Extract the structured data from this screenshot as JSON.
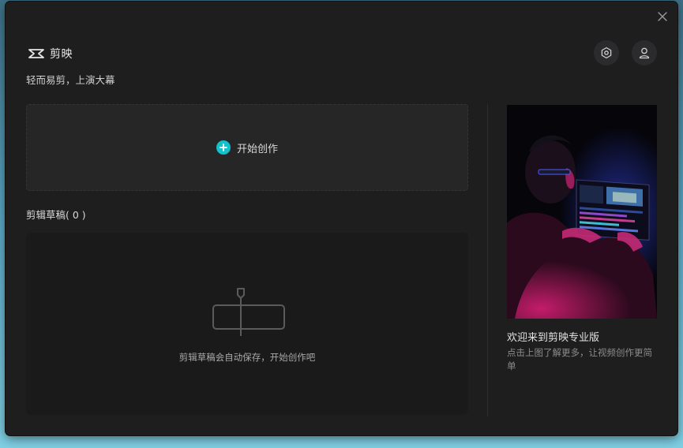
{
  "app": {
    "name": "剪映",
    "tagline": "轻而易剪，上演大幕"
  },
  "header": {
    "settings_icon": "hexagon-settings-icon",
    "user_icon": "user-icon",
    "close_icon": "close-icon"
  },
  "start": {
    "label": "开始创作",
    "icon": "plus-circle-icon",
    "accent": "#12c1c9"
  },
  "drafts": {
    "title": "剪辑草稿( 0 )",
    "empty_text": "剪辑草稿会自动保存，开始创作吧"
  },
  "promo": {
    "title": "欢迎来到剪映专业版",
    "description": "点击上图了解更多，让视频创作更简单"
  }
}
